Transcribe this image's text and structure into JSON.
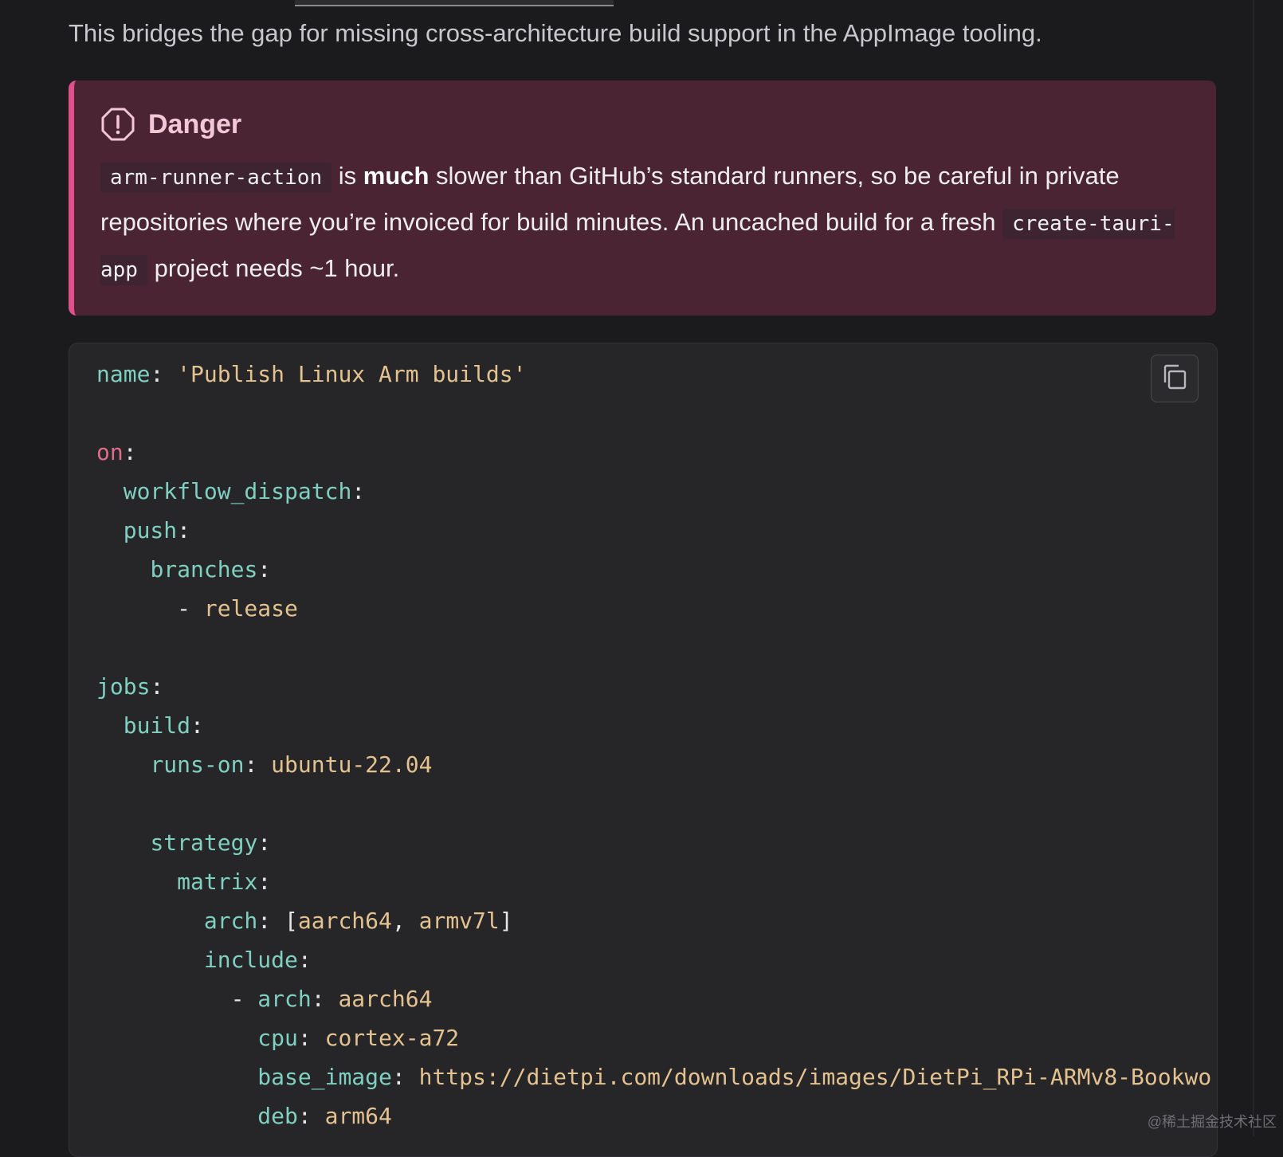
{
  "intro": {
    "text": "This bridges the gap for missing cross-architecture build support in the AppImage tooling."
  },
  "danger": {
    "title": "Danger",
    "code1": "arm-runner-action",
    "t1": " is ",
    "bold": "much",
    "t2": " slower than GitHub’s standard runners, so be careful in private repositories where you’re invoiced for build minutes. An uncached build for a fresh ",
    "code2": "create-tauri-app",
    "t3": " project needs ~1 hour."
  },
  "code": {
    "copy_icon": "copy-icon",
    "lines": [
      [
        {
          "c": "k",
          "t": "name"
        },
        {
          "c": "p",
          "t": ": "
        },
        {
          "c": "s",
          "t": "'Publish Linux Arm builds'"
        }
      ],
      [],
      [
        {
          "c": "kr",
          "t": "on"
        },
        {
          "c": "p",
          "t": ":"
        }
      ],
      [
        {
          "c": "p",
          "t": "  "
        },
        {
          "c": "k",
          "t": "workflow_dispatch"
        },
        {
          "c": "p",
          "t": ":"
        }
      ],
      [
        {
          "c": "p",
          "t": "  "
        },
        {
          "c": "k",
          "t": "push"
        },
        {
          "c": "p",
          "t": ":"
        }
      ],
      [
        {
          "c": "p",
          "t": "    "
        },
        {
          "c": "k",
          "t": "branches"
        },
        {
          "c": "p",
          "t": ":"
        }
      ],
      [
        {
          "c": "p",
          "t": "      - "
        },
        {
          "c": "s",
          "t": "release"
        }
      ],
      [],
      [
        {
          "c": "k",
          "t": "jobs"
        },
        {
          "c": "p",
          "t": ":"
        }
      ],
      [
        {
          "c": "p",
          "t": "  "
        },
        {
          "c": "k",
          "t": "build"
        },
        {
          "c": "p",
          "t": ":"
        }
      ],
      [
        {
          "c": "p",
          "t": "    "
        },
        {
          "c": "k",
          "t": "runs-on"
        },
        {
          "c": "p",
          "t": ": "
        },
        {
          "c": "s",
          "t": "ubuntu-22.04"
        }
      ],
      [],
      [
        {
          "c": "p",
          "t": "    "
        },
        {
          "c": "k",
          "t": "strategy"
        },
        {
          "c": "p",
          "t": ":"
        }
      ],
      [
        {
          "c": "p",
          "t": "      "
        },
        {
          "c": "k",
          "t": "matrix"
        },
        {
          "c": "p",
          "t": ":"
        }
      ],
      [
        {
          "c": "p",
          "t": "        "
        },
        {
          "c": "k",
          "t": "arch"
        },
        {
          "c": "p",
          "t": ": ["
        },
        {
          "c": "s",
          "t": "aarch64"
        },
        {
          "c": "p",
          "t": ", "
        },
        {
          "c": "s",
          "t": "armv7l"
        },
        {
          "c": "p",
          "t": "]"
        }
      ],
      [
        {
          "c": "p",
          "t": "        "
        },
        {
          "c": "k",
          "t": "include"
        },
        {
          "c": "p",
          "t": ":"
        }
      ],
      [
        {
          "c": "p",
          "t": "          - "
        },
        {
          "c": "k",
          "t": "arch"
        },
        {
          "c": "p",
          "t": ": "
        },
        {
          "c": "s",
          "t": "aarch64"
        }
      ],
      [
        {
          "c": "p",
          "t": "            "
        },
        {
          "c": "k",
          "t": "cpu"
        },
        {
          "c": "p",
          "t": ": "
        },
        {
          "c": "s",
          "t": "cortex-a72"
        }
      ],
      [
        {
          "c": "p",
          "t": "            "
        },
        {
          "c": "k",
          "t": "base_image"
        },
        {
          "c": "p",
          "t": ": "
        },
        {
          "c": "s",
          "t": "https://dietpi.com/downloads/images/DietPi_RPi-ARMv8-Bookwo"
        }
      ],
      [
        {
          "c": "p",
          "t": "            "
        },
        {
          "c": "k",
          "t": "deb"
        },
        {
          "c": "p",
          "t": ": "
        },
        {
          "c": "s",
          "t": "arm64"
        }
      ]
    ]
  },
  "watermark": "@稀土掘金技术社区"
}
